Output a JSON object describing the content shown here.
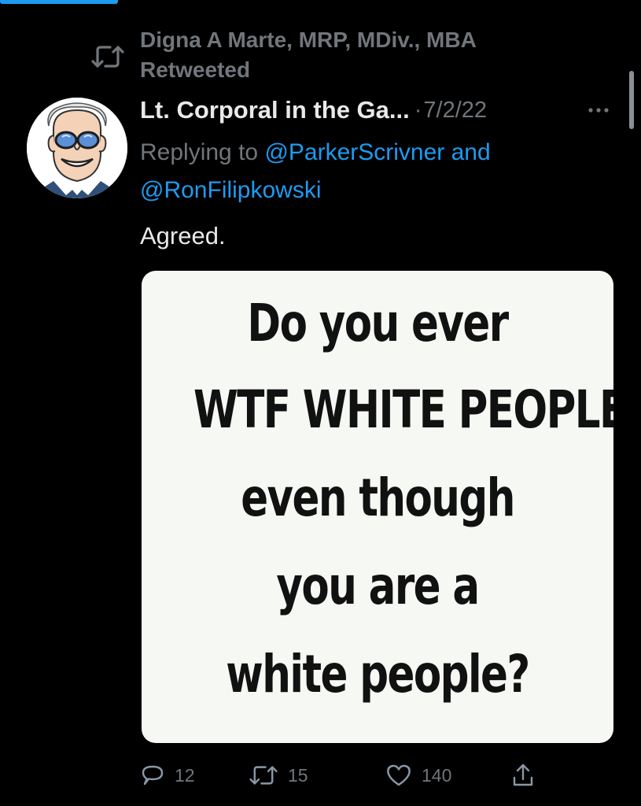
{
  "retweet_banner": {
    "text": "Digna A Marte, MRP, MDiv., MBA Retweeted"
  },
  "tweet": {
    "author_name": "Lt. Corporal in the Ga...",
    "separator": "·",
    "date": "7/2/22",
    "replying_prefix": "Replying to",
    "mention_1": "@ParkerScrivner",
    "mention_joiner": "and",
    "mention_2": "@RonFilipkowski",
    "text": "Agreed.",
    "media_text_lines": [
      "Do you ever",
      "WTF WHITE PEOPLE",
      "even though",
      "you are a",
      "white people?"
    ]
  },
  "actions": {
    "replies": "12",
    "retweets": "15",
    "likes": "140"
  },
  "icons": {
    "retweet_banner_icon": "retweet-icon",
    "more": "more-horizontal-icon",
    "reply": "reply-bubble-icon",
    "retweet": "retweet-icon",
    "like": "heart-icon",
    "share": "share-icon"
  },
  "colors": {
    "background": "#000000",
    "primary_text": "#e7e9ea",
    "secondary_text": "#71767b",
    "accent_blue": "#1d9bf0",
    "media_background": "#f5f8f3"
  }
}
